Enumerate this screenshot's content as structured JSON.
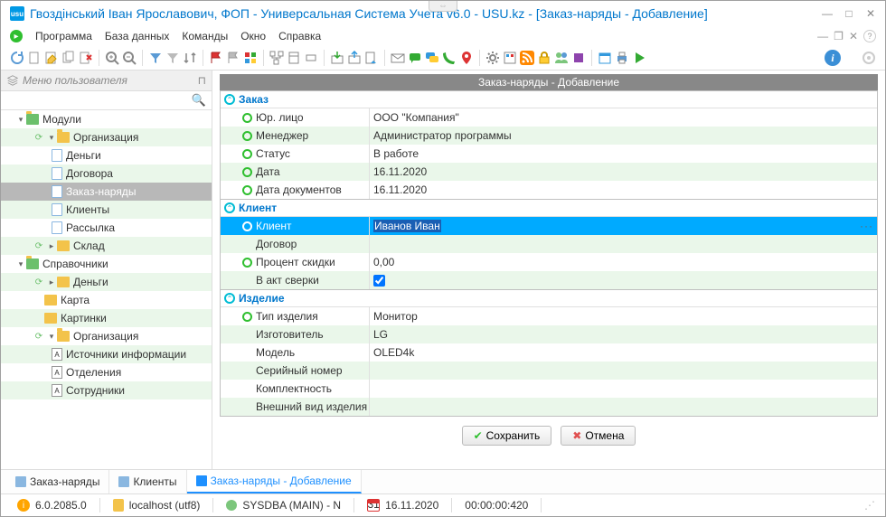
{
  "window": {
    "title": "Гвоздінський Іван Ярославович, ФОП - Универсальная Система Учета v6.0 - USU.kz - [Заказ-наряды - Добавление]"
  },
  "menu": {
    "program": "Программа",
    "database": "База данных",
    "commands": "Команды",
    "window": "Окно",
    "help": "Справка"
  },
  "sidebar": {
    "title": "Меню пользователя",
    "items": {
      "modules": "Модули",
      "organization": "Организация",
      "money": "Деньги",
      "contracts": "Договора",
      "orders": "Заказ-наряды",
      "clients": "Клиенты",
      "mailing": "Рассылка",
      "warehouse": "Склад",
      "refs": "Справочники",
      "ref_money": "Деньги",
      "ref_map": "Карта",
      "ref_images": "Картинки",
      "ref_org": "Организация",
      "ref_sources": "Источники информации",
      "ref_depts": "Отделения",
      "ref_staff": "Сотрудники"
    }
  },
  "form": {
    "title": "Заказ-наряды - Добавление",
    "sec_order": "Заказ",
    "sec_client": "Клиент",
    "sec_product": "Изделие",
    "lbl_entity": "Юр. лицо",
    "val_entity": "ООО \"Компания\"",
    "lbl_manager": "Менеджер",
    "val_manager": "Администратор программы",
    "lbl_status": "Статус",
    "val_status": "В работе",
    "lbl_date": "Дата",
    "val_date": "16.11.2020",
    "lbl_docdate": "Дата документов",
    "val_docdate": "16.11.2020",
    "lbl_client": "Клиент",
    "val_client": "Иванов Иван",
    "lbl_contract": "Договор",
    "val_contract": "",
    "lbl_discount": "Процент скидки",
    "val_discount": "0,00",
    "lbl_act": "В акт сверки",
    "lbl_ptype": "Тип изделия",
    "val_ptype": "Монитор",
    "lbl_maker": "Изготовитель",
    "val_maker": "LG",
    "lbl_model": "Модель",
    "val_model": "OLED4k",
    "lbl_serial": "Серийный номер",
    "val_serial": "",
    "lbl_complete": "Комплектность",
    "val_complete": "",
    "lbl_appearance": "Внешний вид изделия",
    "val_appearance": "",
    "btn_save": "Сохранить",
    "btn_cancel": "Отмена"
  },
  "tabs": {
    "t1": "Заказ-наряды",
    "t2": "Клиенты",
    "t3": "Заказ-наряды - Добавление"
  },
  "status": {
    "version": "6.0.2085.0",
    "host": "localhost (utf8)",
    "user": "SYSDBA (MAIN) - N",
    "date": "16.11.2020",
    "time": "00:00:00:420",
    "cal_day": "31"
  }
}
